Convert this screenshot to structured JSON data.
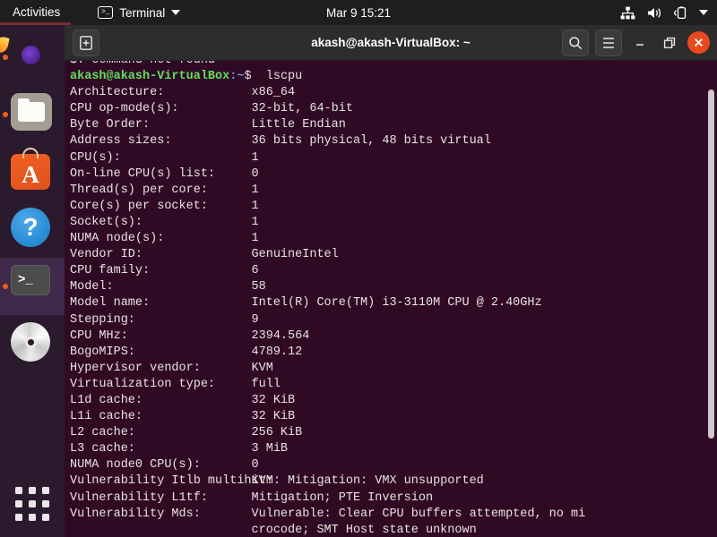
{
  "top_bar": {
    "activities": "Activities",
    "app_menu": {
      "label": "Terminal",
      "icon": "terminal-icon",
      "caret": "chevron-down-icon"
    },
    "clock": "Mar 9  15:21",
    "tray_icons": [
      "network-icon",
      "volume-icon",
      "battery-icon",
      "chevron-down-icon"
    ]
  },
  "dock": {
    "items": [
      {
        "name": "firefox",
        "label": "Firefox",
        "running": true,
        "active": false
      },
      {
        "name": "files",
        "label": "Files",
        "running": true,
        "active": false
      },
      {
        "name": "ubuntu-software",
        "label": "Ubuntu Software",
        "running": false,
        "active": false,
        "glyph": "A"
      },
      {
        "name": "help",
        "label": "Help",
        "running": false,
        "active": false,
        "glyph": "?"
      },
      {
        "name": "terminal",
        "label": "Terminal",
        "running": true,
        "active": true,
        "glyph": ">_"
      },
      {
        "name": "disc",
        "label": "CD/DVD Drive",
        "running": false,
        "active": false
      }
    ],
    "show_applications": "show-applications-grid"
  },
  "window": {
    "title": "akash@akash-VirtualBox: ~",
    "new_tab_label": "+",
    "search_icon": "search-icon",
    "menu_icon": "hamburger-menu-icon",
    "minimize_label": "—",
    "maximize_label": "❐",
    "close_label": "✕"
  },
  "terminal": {
    "colors": {
      "background": "#300a24",
      "foreground": "#e8e2e3",
      "prompt_user": "#5ee05e",
      "prompt_path": "#6a9fe8",
      "titlebar": "#2d2d2d",
      "dock": "#2b192d",
      "accent": "#e8491f"
    },
    "scrollback_cut_line": "$: command not found",
    "prompt": {
      "user_host": "akash@akash-VirtualBox",
      "path": ":~",
      "sigil": "$",
      "command": "lscpu"
    },
    "output": [
      {
        "label": "Architecture:",
        "value": "x86_64"
      },
      {
        "label": "CPU op-mode(s):",
        "value": "32-bit, 64-bit"
      },
      {
        "label": "Byte Order:",
        "value": "Little Endian"
      },
      {
        "label": "Address sizes:",
        "value": "36 bits physical, 48 bits virtual"
      },
      {
        "label": "CPU(s):",
        "value": "1"
      },
      {
        "label": "On-line CPU(s) list:",
        "value": "0"
      },
      {
        "label": "Thread(s) per core:",
        "value": "1"
      },
      {
        "label": "Core(s) per socket:",
        "value": "1"
      },
      {
        "label": "Socket(s):",
        "value": "1"
      },
      {
        "label": "NUMA node(s):",
        "value": "1"
      },
      {
        "label": "Vendor ID:",
        "value": "GenuineIntel"
      },
      {
        "label": "CPU family:",
        "value": "6"
      },
      {
        "label": "Model:",
        "value": "58"
      },
      {
        "label": "Model name:",
        "value": "Intel(R) Core(TM) i3-3110M CPU @ 2.40GHz"
      },
      {
        "label": "Stepping:",
        "value": "9"
      },
      {
        "label": "CPU MHz:",
        "value": "2394.564"
      },
      {
        "label": "BogoMIPS:",
        "value": "4789.12"
      },
      {
        "label": "Hypervisor vendor:",
        "value": "KVM"
      },
      {
        "label": "Virtualization type:",
        "value": "full"
      },
      {
        "label": "L1d cache:",
        "value": "32 KiB"
      },
      {
        "label": "L1i cache:",
        "value": "32 KiB"
      },
      {
        "label": "L2 cache:",
        "value": "256 KiB"
      },
      {
        "label": "L3 cache:",
        "value": "3 MiB"
      },
      {
        "label": "NUMA node0 CPU(s):",
        "value": "0"
      },
      {
        "label": "Vulnerability Itlb multihit:",
        "value": "KVM: Mitigation: VMX unsupported"
      },
      {
        "label": "Vulnerability L1tf:",
        "value": "Mitigation; PTE Inversion"
      },
      {
        "label": "Vulnerability Mds:",
        "value": "Vulnerable: Clear CPU buffers attempted, no mi"
      },
      {
        "label": "",
        "value": "crocode; SMT Host state unknown"
      }
    ]
  }
}
